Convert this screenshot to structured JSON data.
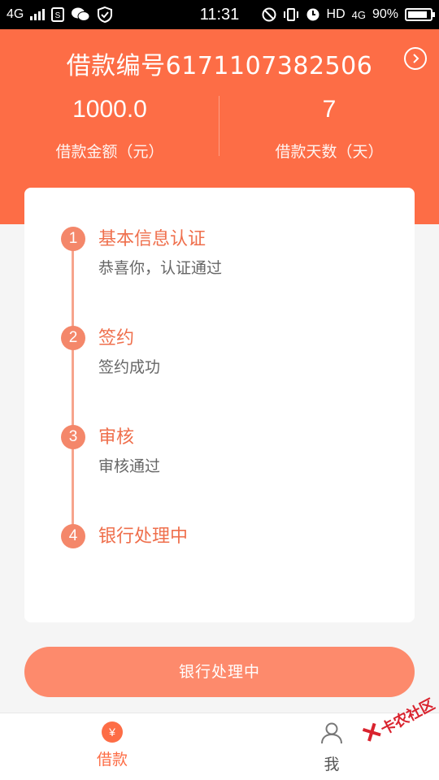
{
  "status_bar": {
    "network_left": "4G",
    "time": "11:31",
    "hd_label": "HD",
    "network_right": "4G",
    "battery_percent": "90%",
    "battery_level": 0.9
  },
  "header": {
    "loan_number": "借款编号6171107382506",
    "amount_value": "1000.0",
    "amount_label": "借款金额（元）",
    "days_value": "7",
    "days_label": "借款天数（天）"
  },
  "steps": [
    {
      "num": "1",
      "title": "基本信息认证",
      "desc": "恭喜你，认证通过"
    },
    {
      "num": "2",
      "title": "签约",
      "desc": "签约成功"
    },
    {
      "num": "3",
      "title": "审核",
      "desc": "审核通过"
    },
    {
      "num": "4",
      "title": "银行处理中",
      "desc": ""
    }
  ],
  "action_button": {
    "label": "银行处理中"
  },
  "bottom_nav": {
    "items": [
      {
        "label": "借款",
        "icon": "yen-coin-icon",
        "icon_glyph": "¥",
        "active": true
      },
      {
        "label": "我",
        "icon": "user-icon",
        "active": false
      }
    ]
  },
  "watermark": {
    "text": "卡农社区"
  },
  "colors": {
    "brand": "#fd6d46",
    "step_circle": "#f4876a",
    "step_title": "#ef6f4c",
    "button": "#fd8a6c"
  }
}
